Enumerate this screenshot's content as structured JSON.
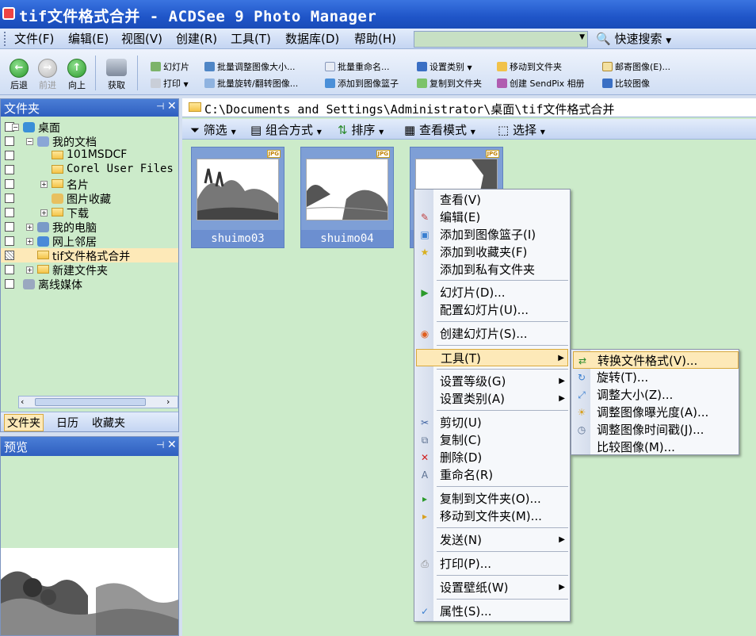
{
  "window": {
    "title": "tif文件格式合并 - ACDSee 9 Photo Manager"
  },
  "menubar": {
    "items": [
      "文件(F)",
      "编辑(E)",
      "视图(V)",
      "创建(R)",
      "工具(T)",
      "数据库(D)",
      "帮助(H)"
    ],
    "search_label": "快速搜索"
  },
  "toolbar": {
    "back": "后退",
    "forward": "前进",
    "up": "向上",
    "acquire": "获取",
    "row1": [
      "幻灯片",
      "批量调整图像大小...",
      "批量重命名...",
      "设置类别",
      "移动到文件夹",
      "邮寄图像(E)..."
    ],
    "row2": [
      "打印",
      "批量旋转/翻转图像...",
      "添加到图像篮子",
      "复制到文件夹",
      "创建 SendPix 相册",
      "比较图像"
    ]
  },
  "folders_panel": {
    "title": "文件夹",
    "tree": [
      {
        "label": "桌面",
        "expander": "−"
      },
      {
        "label": "我的文档",
        "expander": "−"
      },
      {
        "label": "101MSDCF",
        "expander": ""
      },
      {
        "label": "Corel User Files",
        "expander": ""
      },
      {
        "label": "名片",
        "expander": "+"
      },
      {
        "label": "图片收藏",
        "expander": ""
      },
      {
        "label": "下载",
        "expander": "+"
      },
      {
        "label": "我的电脑",
        "expander": "+"
      },
      {
        "label": "网上邻居",
        "expander": "+"
      },
      {
        "label": "tif文件格式合并",
        "expander": ""
      },
      {
        "label": "新建文件夹",
        "expander": "+"
      },
      {
        "label": "离线媒体",
        "expander": ""
      }
    ],
    "tabs": [
      "文件夹",
      "日历",
      "收藏夹"
    ]
  },
  "preview_panel": {
    "title": "预览"
  },
  "main": {
    "path": "C:\\Documents and Settings\\Administrator\\桌面\\tif文件格式合并",
    "viewbar": [
      "筛选",
      "组合方式",
      "排序",
      "查看模式",
      "选择"
    ],
    "thumbnails": [
      {
        "name": "shuimo03",
        "badge": "JPG"
      },
      {
        "name": "shuimo04",
        "badge": "JPG"
      },
      {
        "name": "",
        "badge": "JPG"
      }
    ]
  },
  "context_menu": {
    "items": [
      "查看(V)",
      "编辑(E)",
      "添加到图像篮子(I)",
      "添加到收藏夹(F)",
      "添加到私有文件夹",
      "幻灯片(D)...",
      "配置幻灯片(U)...",
      "创建幻灯片(S)...",
      "工具(T)",
      "设置等级(G)",
      "设置类别(A)",
      "剪切(U)",
      "复制(C)",
      "删除(D)",
      "重命名(R)",
      "复制到文件夹(O)...",
      "移动到文件夹(M)...",
      "发送(N)",
      "打印(P)...",
      "设置壁纸(W)",
      "属性(S)..."
    ]
  },
  "submenu": {
    "items": [
      "转换文件格式(V)...",
      "旋转(T)...",
      "调整大小(Z)...",
      "调整图像曝光度(A)...",
      "调整图像时间戳(J)...",
      "比较图像(M)..."
    ]
  },
  "colors": {
    "accent": "#2f5fbf",
    "panel_bg": "#ccebca",
    "highlight": "#fde9b8"
  }
}
